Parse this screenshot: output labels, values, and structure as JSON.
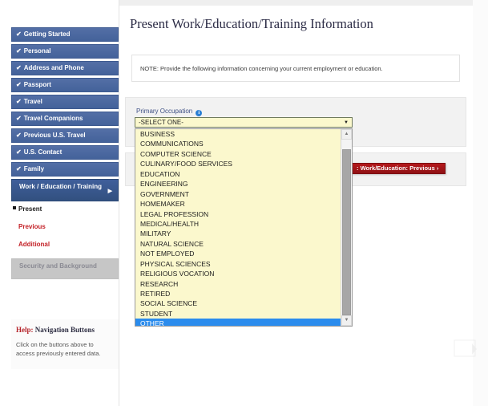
{
  "page": {
    "title": "Present Work/Education/Training Information",
    "note": "NOTE: Provide the following information concerning your current employment or education."
  },
  "sidebar": {
    "items": [
      {
        "label": "Getting Started",
        "check": "✔",
        "state": "completed"
      },
      {
        "label": "Personal",
        "check": "✔",
        "state": "completed"
      },
      {
        "label": "Address and Phone",
        "check": "✔",
        "state": "completed"
      },
      {
        "label": "Passport",
        "check": "✔",
        "state": "completed"
      },
      {
        "label": "Travel",
        "check": "✔",
        "state": "completed"
      },
      {
        "label": "Travel Companions",
        "check": "✔",
        "state": "completed"
      },
      {
        "label": "Previous U.S. Travel",
        "check": "✔",
        "state": "completed"
      },
      {
        "label": "U.S. Contact",
        "check": "✔",
        "state": "completed"
      },
      {
        "label": "Family",
        "check": "✔",
        "state": "completed"
      }
    ],
    "current": {
      "label": "Work / Education / Training",
      "arrow": "▶"
    },
    "sub_items": [
      {
        "label": "Present",
        "state": "active"
      },
      {
        "label": "Previous",
        "state": "link"
      },
      {
        "label": "Additional",
        "state": "link"
      }
    ],
    "disabled_item": {
      "label": "Security and Background"
    }
  },
  "help": {
    "title_label": "Help:",
    "title_topic": "Navigation Buttons",
    "body": "Click on the buttons above to access previously entered data."
  },
  "form": {
    "field_label": "Primary Occupation",
    "info_icon": "i",
    "select_value": "-SELECT ONE-",
    "select_arrow": "▼",
    "options": [
      "BUSINESS",
      "COMMUNICATIONS",
      "COMPUTER SCIENCE",
      "CULINARY/FOOD SERVICES",
      "EDUCATION",
      "ENGINEERING",
      "GOVERNMENT",
      "HOMEMAKER",
      "LEGAL PROFESSION",
      "MEDICAL/HEALTH",
      "MILITARY",
      "NATURAL SCIENCE",
      "NOT EMPLOYED",
      "PHYSICAL SCIENCES",
      "RELIGIOUS VOCATION",
      "RESEARCH",
      "RETIRED",
      "SOCIAL SCIENCE",
      "STUDENT",
      "OTHER"
    ],
    "selected_option": "OTHER",
    "scroll_up_arrow": "▲",
    "scroll_down_arrow": "▼"
  },
  "actions": {
    "previous_button": ": Work/Education: Previous ›"
  },
  "colors": {
    "nav_blue": "#44629a",
    "nav_current": "#32507f",
    "link_red": "#c32026",
    "button_red": "#b5191c",
    "select_yellow": "#fbf8cd",
    "highlight_blue": "#2b8ced"
  }
}
